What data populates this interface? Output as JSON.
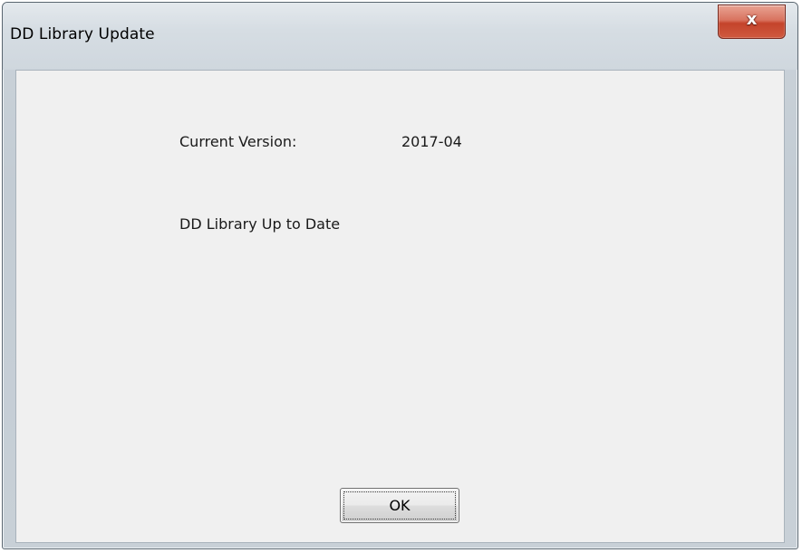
{
  "window": {
    "title": "DD Library Update",
    "close_icon": "close-icon",
    "close_glyph": "x"
  },
  "content": {
    "current_version_label": "Current Version:",
    "current_version_value": "2017-04",
    "status_message": "DD Library Up to Date"
  },
  "buttons": {
    "ok_label": "OK"
  },
  "colors": {
    "client_background": "#f0f0f0",
    "close_button": "#c4432b",
    "frame": "#c9d1d8"
  }
}
